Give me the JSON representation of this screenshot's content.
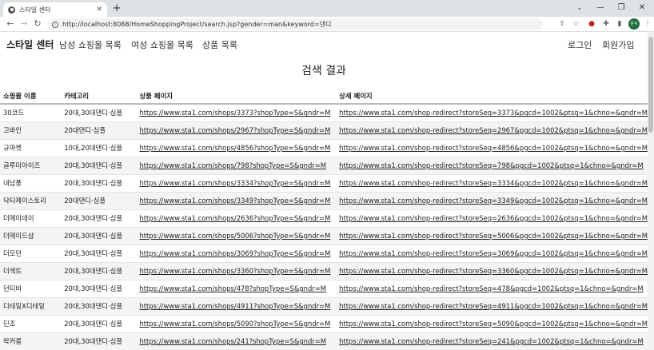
{
  "browser": {
    "tab_title": "스타일 센터",
    "url": "http://localhost:8088/HomeShoppingProject/search.jsp?gender=man&keyword=댄디",
    "profile_label": "문서"
  },
  "site": {
    "brand": "스타일 센터",
    "menu": [
      "남성 쇼핑몰 목록",
      "여성 쇼핑몰 목록",
      "상품 목록"
    ],
    "login": "로그인",
    "signup": "회원가입"
  },
  "page_title": "검색 결과",
  "table": {
    "headers": [
      "쇼핑몰 이름",
      "카테고리",
      "상품 페이지",
      "상세 페이지"
    ],
    "rows": [
      [
        "30코드",
        "20대,30대댄디·심플",
        "https://www.sta1.com/shops/3373?shopType=S&gndr=M",
        "https://www.sta1.com/shop-redirect?storeSeq=3373&pgcd=1002&ptsq=1&chno=&gndr=M"
      ],
      [
        "고바인",
        "20대댄디·심플",
        "https://www.sta1.com/shops/2967?shopType=S&gndr=M",
        "https://www.sta1.com/shop-redirect?storeSeq=2967&pgcd=1002&ptsq=1&chno=&gndr=M"
      ],
      [
        "규마켓",
        "10대,20대댄디·심플",
        "https://www.sta1.com/shops/4856?shopType=S&gndr=M",
        "https://www.sta1.com/shop-redirect?storeSeq=4856&pgcd=1002&ptsq=1&chno=&gndr=M"
      ],
      [
        "글루미아이즈",
        "20대,30대댄디·심플",
        "https://www.sta1.com/shops/798?shopType=S&gndr=M",
        "https://www.sta1.com/shop-redirect?storeSeq=798&pgcd=1002&ptsq=1&chno=&gndr=M"
      ],
      [
        "내남풍",
        "20대,30대댄디·심플",
        "https://www.sta1.com/shops/3334?shopType=S&gndr=M",
        "https://www.sta1.com/shop-redirect?storeSeq=3334&pgcd=1002&ptsq=1&chno=&gndr=M"
      ],
      [
        "닥터제이스토리",
        "20대댄디·심플",
        "https://www.sta1.com/shops/3349?shopType=S&gndr=M",
        "https://www.sta1.com/shop-redirect?storeSeq=3349&pgcd=1002&ptsq=1&chno=&gndr=M"
      ],
      [
        "더메이데이",
        "20대,30대댄디·심플",
        "https://www.sta1.com/shops/2636?shopType=S&gndr=M",
        "https://www.sta1.com/shop-redirect?storeSeq=2636&pgcd=1002&ptsq=1&chno=&gndr=M"
      ],
      [
        "더메이드샵",
        "20대,30대댄디·심플",
        "https://www.sta1.com/shops/5006?shopType=S&gndr=M",
        "https://www.sta1.com/shop-redirect?storeSeq=5006&pgcd=1002&ptsq=1&chno=&gndr=M"
      ],
      [
        "더모던",
        "20대,30대댄디·심플",
        "https://www.sta1.com/shops/3069?shopType=S&gndr=M",
        "https://www.sta1.com/shop-redirect?storeSeq=3069&pgcd=1002&ptsq=1&chno=&gndr=M"
      ],
      [
        "더섹트",
        "20대,30대댄디·심플",
        "https://www.sta1.com/shops/3360?shopType=S&gndr=M",
        "https://www.sta1.com/shop-redirect?storeSeq=3360&pgcd=1002&ptsq=1&chno=&gndr=M"
      ],
      [
        "던티비",
        "20대,30대댄디·심플",
        "https://www.sta1.com/shops/478?shopType=S&gndr=M",
        "https://www.sta1.com/shop-redirect?storeSeq=478&pgcd=1002&ptsq=1&chno=&gndr=M"
      ],
      [
        "디테일X디테일",
        "20대,30대댄디·심플",
        "https://www.sta1.com/shops/4911?shopType=S&gndr=M",
        "https://www.sta1.com/shop-redirect?storeSeq=4911&pgcd=1002&ptsq=1&chno=&gndr=M"
      ],
      [
        "딘조",
        "20대,30대댄디·심플",
        "https://www.sta1.com/shops/5090?shopType=S&gndr=M",
        "https://www.sta1.com/shop-redirect?storeSeq=5090&pgcd=1002&ptsq=1&chno=&gndr=M"
      ],
      [
        "락커룸",
        "20대,30대댄디·심플",
        "https://www.sta1.com/shops/241?shopType=S&gndr=M",
        "https://www.sta1.com/shop-redirect?storeSeq=241&pgcd=1002&ptsq=1&chno=&gndr=M"
      ]
    ]
  }
}
